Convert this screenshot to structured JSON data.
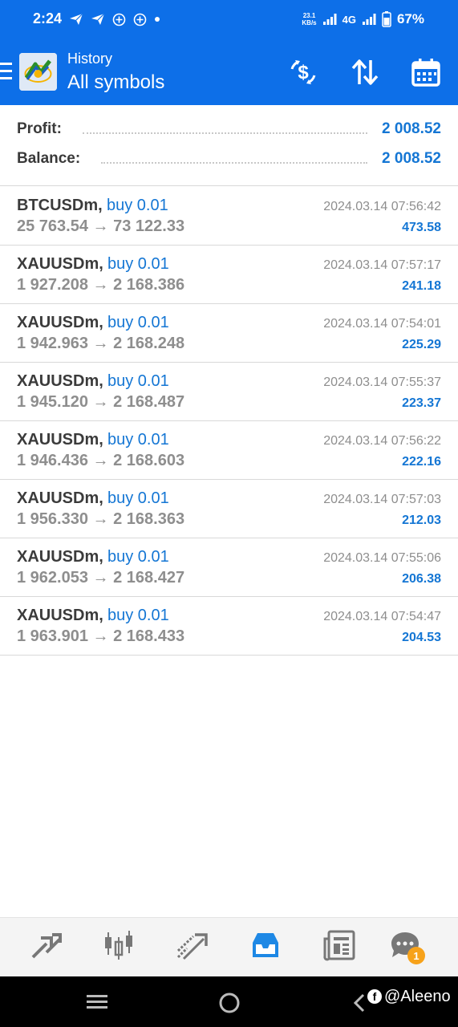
{
  "status_bar": {
    "time": "2:24",
    "net_speed_value": "23.1",
    "net_speed_unit": "KB/s",
    "network": "4G",
    "battery": "67%"
  },
  "toolbar": {
    "subtitle": "History",
    "title": "All symbols"
  },
  "summary": {
    "profit_label": "Profit:",
    "profit_value": "2 008.52",
    "balance_label": "Balance:",
    "balance_value": "2 008.52"
  },
  "trades": [
    {
      "symbol": "BTCUSDm,",
      "side": "buy 0.01",
      "prices": "25 763.54 → 73 122.33",
      "date": "2024.03.14 07:56:42",
      "profit": "473.58"
    },
    {
      "symbol": "XAUUSDm,",
      "side": "buy 0.01",
      "prices": "1 927.208 → 2 168.386",
      "date": "2024.03.14 07:57:17",
      "profit": "241.18"
    },
    {
      "symbol": "XAUUSDm,",
      "side": "buy 0.01",
      "prices": "1 942.963 → 2 168.248",
      "date": "2024.03.14 07:54:01",
      "profit": "225.29"
    },
    {
      "symbol": "XAUUSDm,",
      "side": "buy 0.01",
      "prices": "1 945.120 → 2 168.487",
      "date": "2024.03.14 07:55:37",
      "profit": "223.37"
    },
    {
      "symbol": "XAUUSDm,",
      "side": "buy 0.01",
      "prices": "1 946.436 → 2 168.603",
      "date": "2024.03.14 07:56:22",
      "profit": "222.16"
    },
    {
      "symbol": "XAUUSDm,",
      "side": "buy 0.01",
      "prices": "1 956.330 → 2 168.363",
      "date": "2024.03.14 07:57:03",
      "profit": "212.03"
    },
    {
      "symbol": "XAUUSDm,",
      "side": "buy 0.01",
      "prices": "1 962.053 → 2 168.427",
      "date": "2024.03.14 07:55:06",
      "profit": "206.38"
    },
    {
      "symbol": "XAUUSDm,",
      "side": "buy 0.01",
      "prices": "1 963.901 → 2 168.433",
      "date": "2024.03.14 07:54:47",
      "profit": "204.53"
    }
  ],
  "bottom_nav": {
    "items": [
      "quotes-icon",
      "chart-icon",
      "trade-icon",
      "history-icon",
      "news-icon",
      "chat-icon"
    ],
    "active": "history-icon",
    "chat_badge": "1"
  },
  "watermark": {
    "text": "@Aleeno"
  },
  "colors": {
    "brand_blue": "#0d6fe8",
    "accent_blue": "#1476d4",
    "badge_orange": "#f7a21a"
  }
}
